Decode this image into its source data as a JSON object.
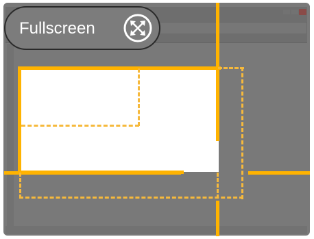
{
  "overlay": {
    "fullscreen_label": "Fullscreen",
    "fullscreen_icon": "expand-arrows-icon"
  },
  "colors": {
    "guide": "#ffb300",
    "dimmed_background": "#797979",
    "preview_window": "#ffffff",
    "pill_background": "#7c7c7c",
    "pill_border": "#2a2a2a",
    "close_button": "#8a4b48"
  }
}
